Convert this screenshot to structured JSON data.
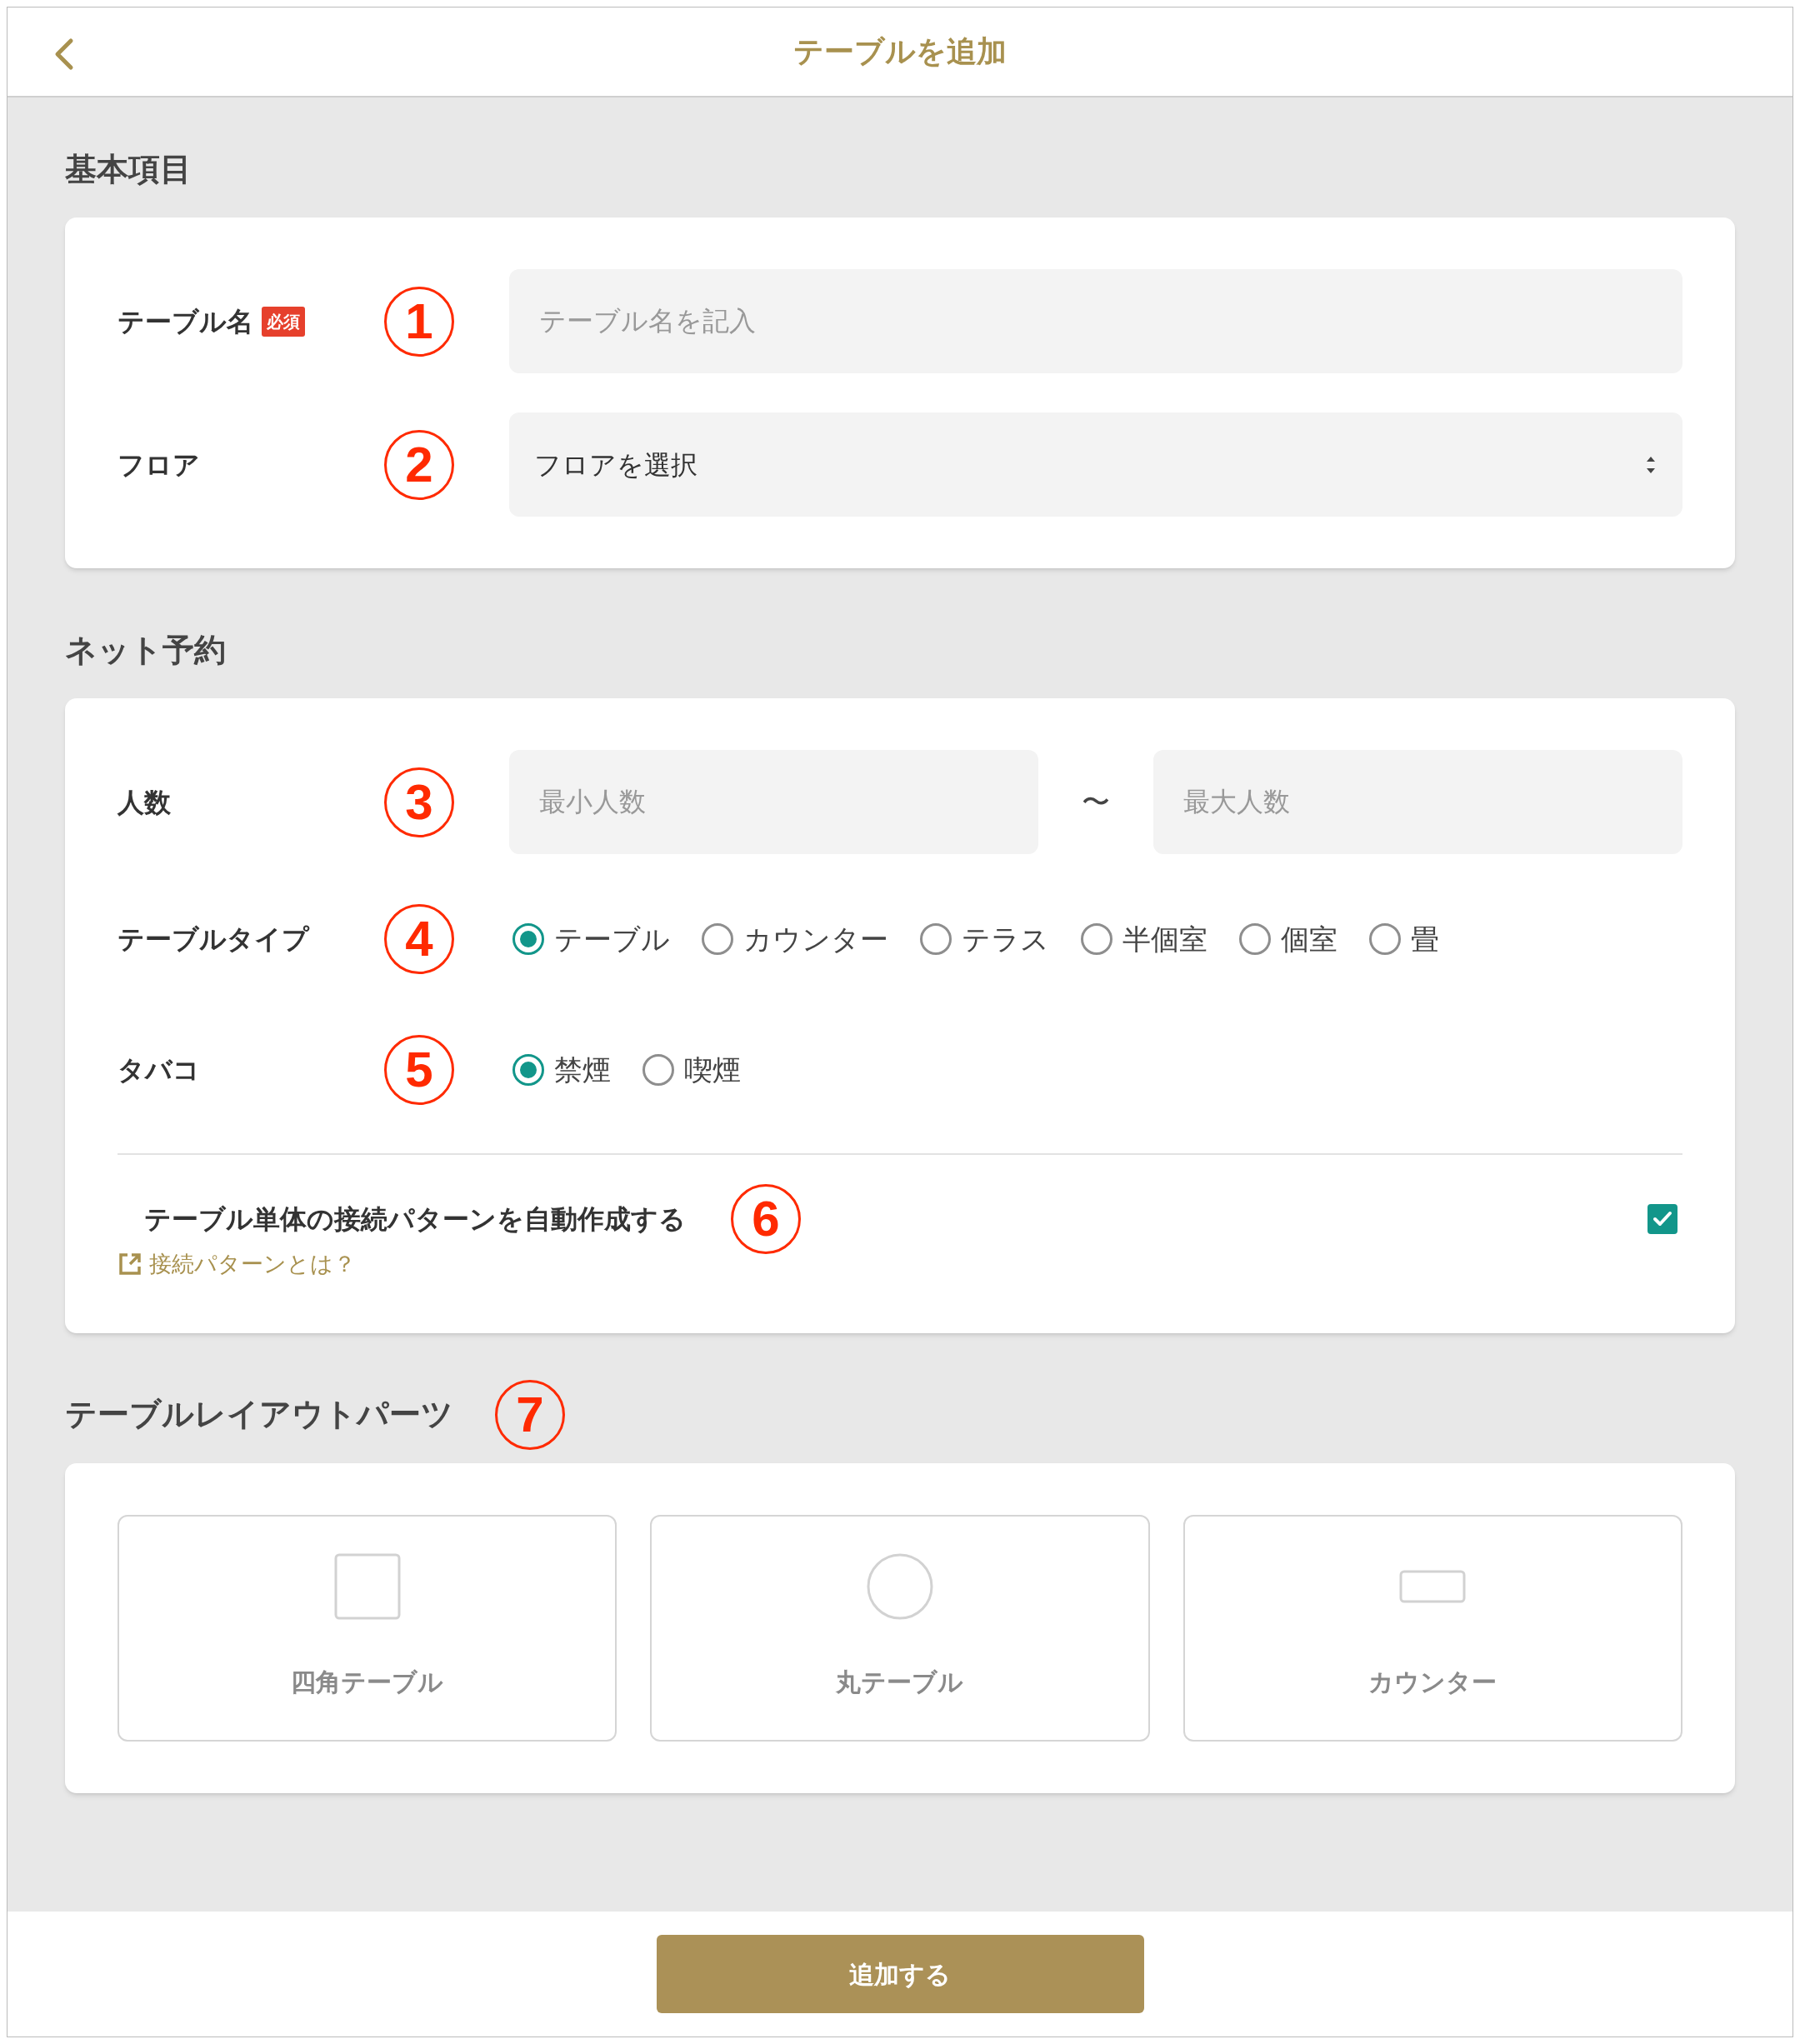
{
  "header": {
    "back_icon": true,
    "title": "テーブルを追加"
  },
  "sections": [
    {
      "heading": "基本項目",
      "rows": [
        {
          "kind": "text",
          "label": "テーブル名",
          "badge": "必須",
          "callout": "1",
          "placeholder": "テーブル名を記入"
        },
        {
          "kind": "select",
          "label": "フロア",
          "callout": "2",
          "value": "フロアを選択"
        }
      ]
    },
    {
      "heading": "ネット予約",
      "rows": [
        {
          "kind": "range",
          "label": "人数",
          "callout": "3",
          "min_placeholder": "最小人数",
          "separator": "〜",
          "max_placeholder": "最大人数"
        },
        {
          "kind": "radio",
          "label": "テーブルタイプ",
          "callout": "4",
          "options": [
            {
              "label": "テーブル",
              "selected": true
            },
            {
              "label": "カウンター",
              "selected": false
            },
            {
              "label": "テラス",
              "selected": false
            },
            {
              "label": "半個室",
              "selected": false
            },
            {
              "label": "個室",
              "selected": false
            },
            {
              "label": "畳",
              "selected": false
            }
          ]
        },
        {
          "kind": "radio",
          "label": "タバコ",
          "callout": "5",
          "options": [
            {
              "label": "禁煙",
              "selected": true
            },
            {
              "label": "喫煙",
              "selected": false
            }
          ]
        }
      ],
      "checkbox": {
        "label": "テーブル単体の接続パターンを自動作成する",
        "callout": "6",
        "checked": true,
        "link": "接続パターンとは？"
      }
    },
    {
      "heading": "テーブルレイアウトパーツ",
      "callout": "7",
      "parts": [
        {
          "kind": "square",
          "label": "四角テーブル"
        },
        {
          "kind": "circle",
          "label": "丸テーブル"
        },
        {
          "kind": "counter",
          "label": "カウンター"
        }
      ]
    }
  ],
  "submit": "追加する"
}
